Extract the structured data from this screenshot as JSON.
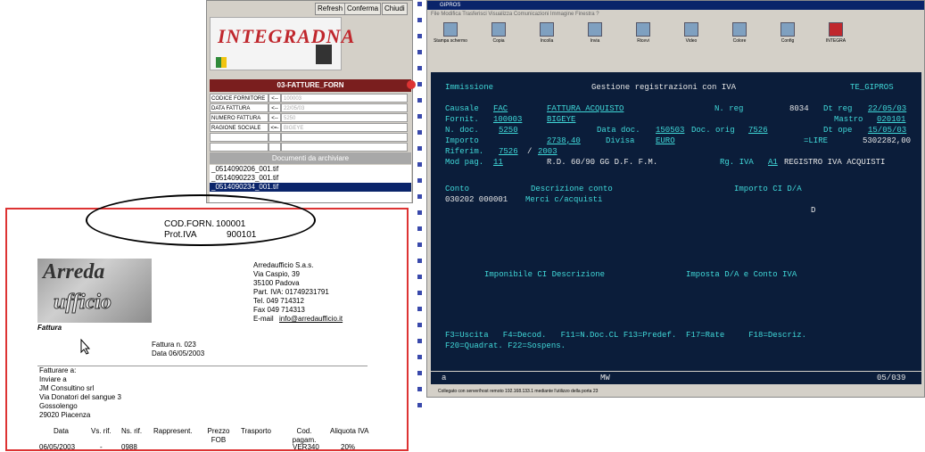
{
  "left_app": {
    "toolbar": [
      "Refresh",
      "Conferma",
      "Chiudi"
    ],
    "logo_text": "INTEGRADNA",
    "panel_title": "03-FATTURE_FORN",
    "fields": [
      {
        "label": "CODICE FORNITORE",
        "op": "<--O",
        "value": "100003"
      },
      {
        "label": "DATA FATTURA",
        "op": "<--O",
        "value": "22/05/03"
      },
      {
        "label": "NUMERO FATTURA",
        "op": "<--O",
        "value": "5250"
      },
      {
        "label": "RAGIONE SOCIALE",
        "op": "<=-",
        "value": "BIGEYE"
      }
    ],
    "docs_header": "Documenti da archiviare",
    "files": [
      "_0514090206_001.tif",
      "_0514090223_001.tif",
      "_0514090234_001.tif"
    ]
  },
  "terminal": {
    "title": "GIPROS",
    "menu": "File  Modifica  Trasferisci  Visualizza  Comunicazioni  Immagine  Finestra  ?",
    "tools": [
      "Stampa schermo",
      "Copia",
      "Incolla",
      "Invia",
      "Ricevi",
      "Video",
      "Colore",
      "Config",
      "INTEGRA"
    ],
    "header": {
      "left": "Immissione",
      "center": "Gestione registrazioni con IVA",
      "right": "TE_GIPROS"
    },
    "r1": {
      "l1": "Causale",
      "v1": "FAC",
      "v2": "FATTURA ACQUISTO",
      "l2": "N. reg",
      "v3": "8034",
      "l3": "Dt reg",
      "v4": "22/05/03"
    },
    "r2": {
      "l1": "Fornit.",
      "v1": "100003",
      "v2": "BIGEYE",
      "l2": "Mastro",
      "v3": "020101"
    },
    "r3": {
      "l1": "N. doc.",
      "v1": "5250",
      "l2": "Data doc.",
      "v2": "150503",
      "l3": "Doc. orig",
      "v3": "7526",
      "l4": "Dt ope",
      "v4": "15/05/03"
    },
    "r4": {
      "l1": "Importo",
      "v1": "2738,40",
      "l2": "Divisa",
      "v2": "EURO",
      "l3": "=LIRE",
      "v3": "5302282,00"
    },
    "r5": {
      "l1": "Riferim.",
      "v1": "7526",
      "sep": "/",
      "v2": "2003"
    },
    "r6": {
      "l1": "Mod pag.",
      "v1": "11",
      "t1": "R.D. 60/90 GG D.F. F.M.",
      "l2": "Rg. IVA",
      "v2": "A1",
      "t2": "REGISTRO IVA ACQUISTI"
    },
    "cols": {
      "c1": "Conto",
      "c2": "Descrizione conto",
      "c3": "Importo CI D/A"
    },
    "line": {
      "conto": "030202 000001",
      "descr": "Merci c/acquisti",
      "da": "D"
    },
    "cols2": {
      "c1": "Imponibile CI Descrizione",
      "c2": "Imposta D/A e Conto IVA"
    },
    "fkeys1": "F3=Uscita   F4=Decod.   F11=N.Doc.CL F13=Predef.  F17=Rate     F18=Descriz.",
    "fkeys2": "F20=Quadrat. F22=Sospens.",
    "status": {
      "a": "a",
      "mw": "MW",
      "pos": "05/039"
    },
    "conn": "Collegato con server/host remoto 192.168.133.1 mediante l'utilizzo della porta 23"
  },
  "invoice": {
    "cod_forn_label": "COD.FORN.",
    "cod_forn": "100001",
    "prot_iva_label": "Prot.IVA",
    "prot_iva": "900101",
    "logo1": "Arreda",
    "logo2": "ufficio",
    "doc_type": "Fattura",
    "company": [
      "Arredaufficio S.a.s.",
      "Via Caspio, 39",
      "35100 Padova",
      "Part. IVA: 01749231791",
      "Tel. 049 714312",
      "Fax 049 714313"
    ],
    "email_label": "E-mail",
    "email": "info@arredaufficio.it",
    "fattura_n": "Fattura n. 023",
    "data": "Data 06/05/2003",
    "fatturare": "Fatturare a:",
    "inviare": "Inviare a",
    "client": [
      "JM Consultino srl",
      "Via Donatori del sangue 3",
      "Gossolengo",
      "29020 Piacenza"
    ],
    "table_headers": [
      "Data",
      "Vs. rif.",
      "Ns. rif.",
      "Rappresent.",
      "Prezzo FOB",
      "Trasporto",
      "Cod. pagam.",
      "Aliquota IVA"
    ],
    "row": [
      "06/05/2003",
      "-",
      "0988",
      "VER340",
      "20%"
    ]
  }
}
